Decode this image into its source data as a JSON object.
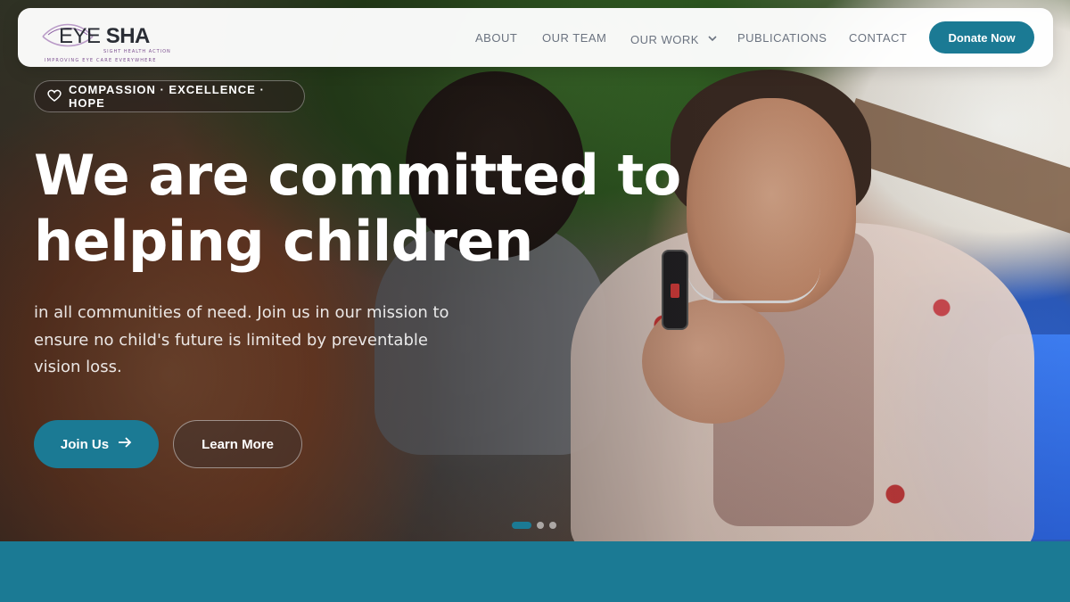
{
  "brand": {
    "name_part1": "EYE",
    "name_part2": "SHA",
    "subtitle": "SIGHT HEALTH ACTION",
    "tagline": "IMPROVING EYE CARE EVERYWHERE"
  },
  "nav": {
    "items": [
      {
        "label": "ABOUT"
      },
      {
        "label": "OUR TEAM"
      },
      {
        "label": "OUR WORK"
      },
      {
        "label": "PUBLICATIONS"
      },
      {
        "label": "CONTACT"
      }
    ],
    "donate_label": "Donate Now"
  },
  "hero": {
    "badge": "COMPASSION · EXCELLENCE · HOPE",
    "headline_line1": "We are committed to",
    "headline_line2": "helping children",
    "subtext": "in all communities of need. Join us in our mission to ensure no child's future is limited by preventable vision loss.",
    "join_label": "Join Us",
    "learn_label": "Learn More",
    "carousel": {
      "slides": 3,
      "active": 1
    }
  },
  "colors": {
    "accent": "#1b7a94",
    "nav_text": "#6b7380",
    "logo_purple": "#7b4e8f"
  },
  "icons": {
    "badge": "heart-icon",
    "join": "arrow-right-icon",
    "dropdown": "chevron-down-icon"
  }
}
